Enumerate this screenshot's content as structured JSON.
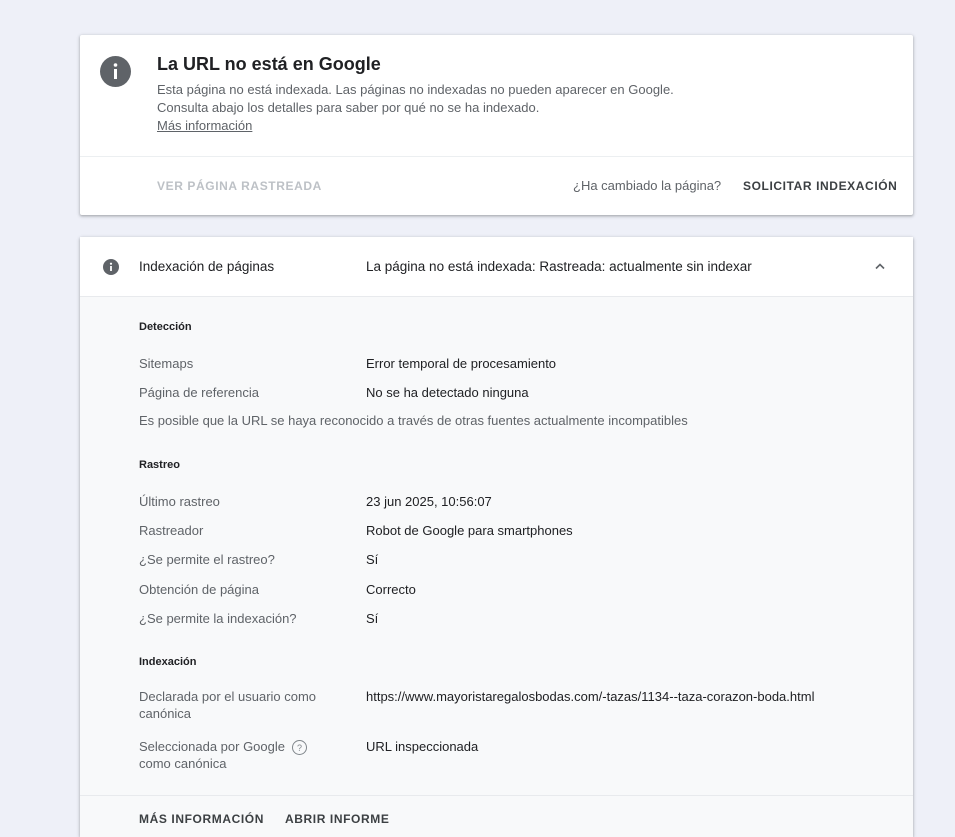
{
  "status": {
    "title": "La URL no está en Google",
    "description": "Esta página no está indexada. Las páginas no indexadas no pueden aparecer en Google. Consulta abajo los detalles para saber por qué no se ha indexado.",
    "more_link": "Más información",
    "view_crawled": "VER PÁGINA RASTREADA",
    "changed_question": "¿Ha cambiado la página?",
    "request_indexing": "SOLICITAR INDEXACIÓN"
  },
  "indexing": {
    "label": "Indexación de páginas",
    "value": "La página no está indexada: Rastreada: actualmente sin indexar",
    "sections": {
      "detection": {
        "title": "Detección",
        "sitemaps_label": "Sitemaps",
        "sitemaps_value": "Error temporal de procesamiento",
        "referrer_label": "Página de referencia",
        "referrer_value": "No se ha detectado ninguna",
        "note": "Es posible que la URL se haya reconocido a través de otras fuentes actualmente incompatibles"
      },
      "crawl": {
        "title": "Rastreo",
        "last_crawl_label": "Último rastreo",
        "last_crawl_value": "23 jun 2025, 10:56:07",
        "crawler_label": "Rastreador",
        "crawler_value": "Robot de Google para smartphones",
        "crawl_allowed_label": "¿Se permite el rastreo?",
        "crawl_allowed_value": "Sí",
        "page_fetch_label": "Obtención de página",
        "page_fetch_value": "Correcto",
        "index_allowed_label": "¿Se permite la indexación?",
        "index_allowed_value": "Sí"
      },
      "indexing": {
        "title": "Indexación",
        "user_canonical_label": "Declarada por el usuario como canónica",
        "user_canonical_value": "https://www.mayoristaregalosbodas.com/-tazas/1134--taza-corazon-boda.html",
        "google_canonical_label": "Seleccionada por Google como canónica",
        "google_canonical_value": "URL inspeccionada"
      }
    },
    "footer": {
      "more_info": "MÁS INFORMACIÓN",
      "open_report": "ABRIR INFORME"
    }
  }
}
